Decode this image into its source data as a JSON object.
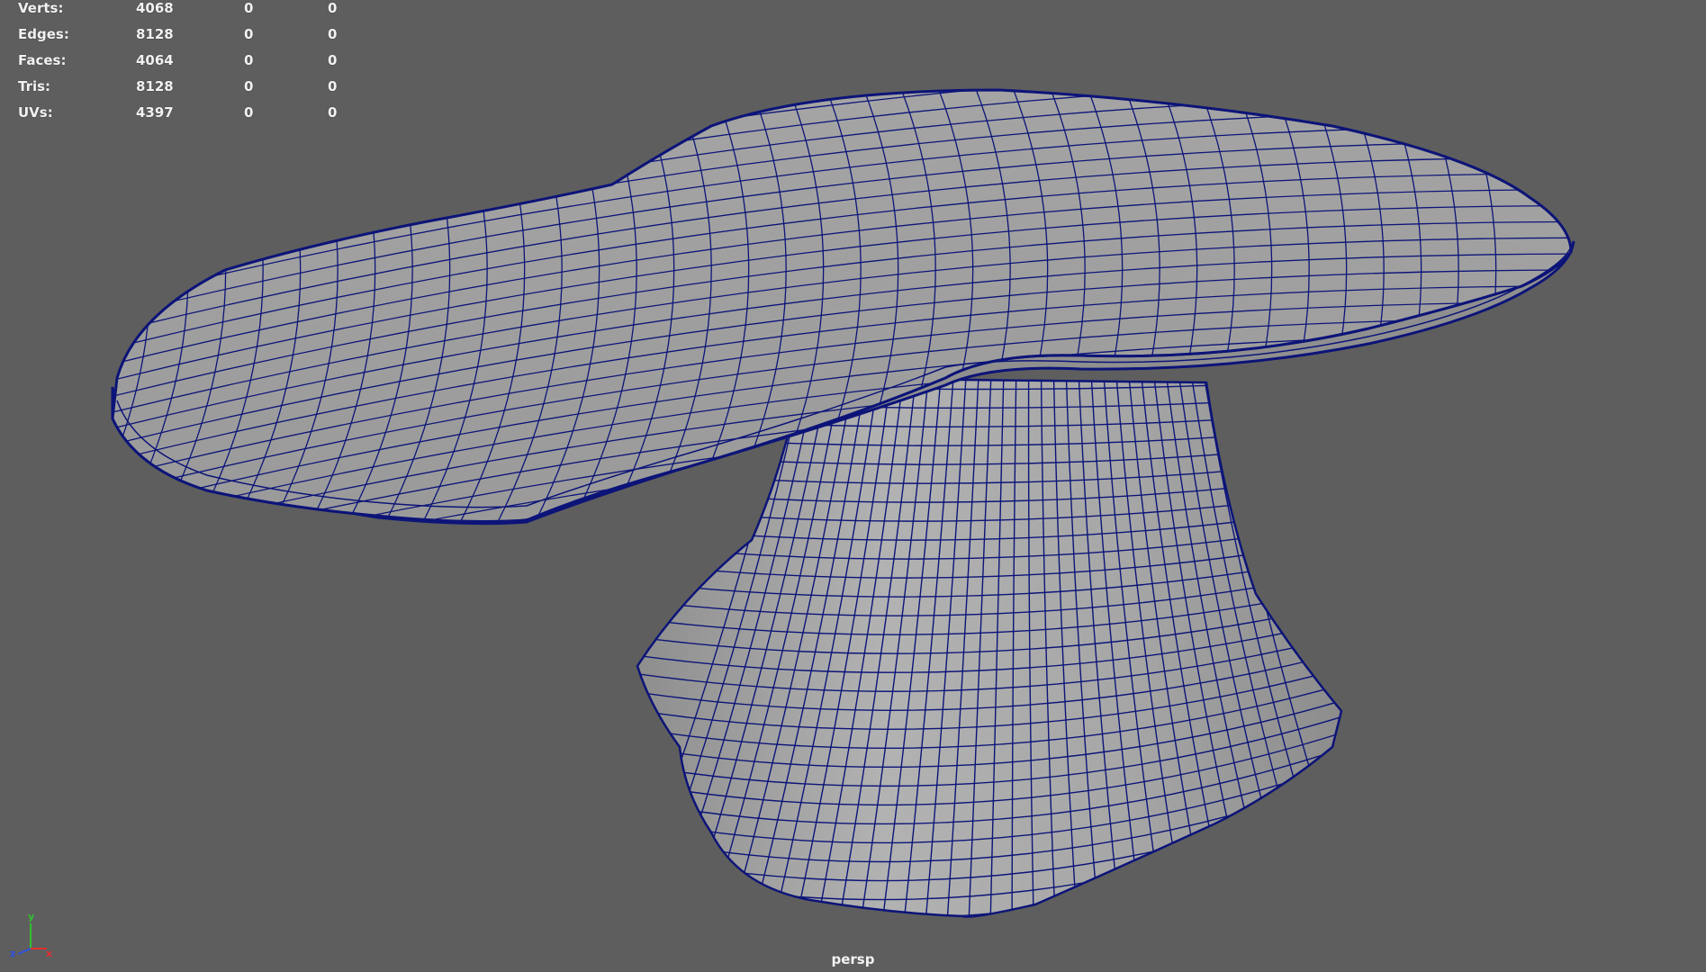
{
  "hud": {
    "rows": [
      {
        "label": "Verts:",
        "values": [
          "4068",
          "0",
          "0"
        ]
      },
      {
        "label": "Edges:",
        "values": [
          "8128",
          "0",
          "0"
        ]
      },
      {
        "label": "Faces:",
        "values": [
          "4064",
          "0",
          "0"
        ]
      },
      {
        "label": "Tris:",
        "values": [
          "8128",
          "0",
          "0"
        ]
      },
      {
        "label": "UVs:",
        "values": [
          "4397",
          "0",
          "0"
        ]
      }
    ]
  },
  "camera": "persp",
  "axis": {
    "x": "x",
    "y": "y",
    "z": "z"
  },
  "colors": {
    "background": "#5e5e5e",
    "wireframe": "#0c1478",
    "surface": "#a9a9a9",
    "axis_x": "#e03030",
    "axis_y": "#30c030",
    "axis_z": "#3050e0"
  },
  "model_icons": [
    "table-top-mesh",
    "pedestal-mesh"
  ]
}
